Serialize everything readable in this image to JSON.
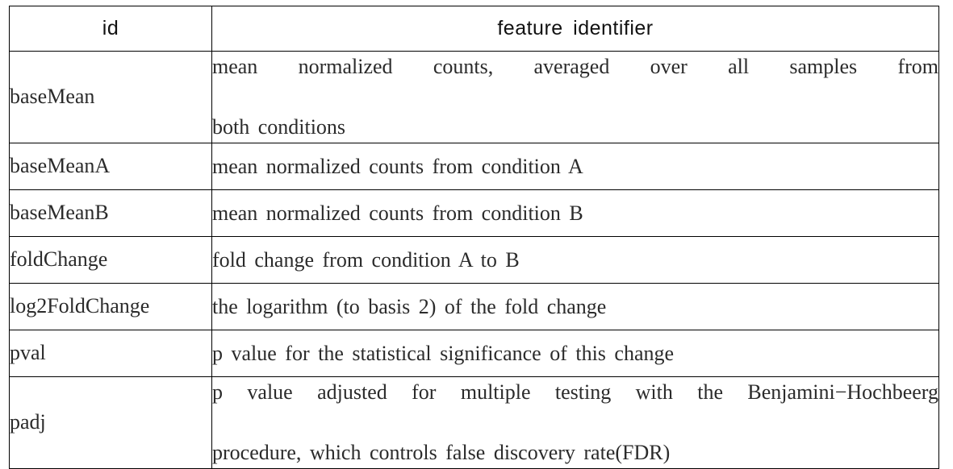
{
  "table": {
    "columns": [
      {
        "key": "id",
        "label": "id"
      },
      {
        "key": "feature_identifier",
        "label": "feature  identifier"
      }
    ],
    "rows": [
      {
        "id": "baseMean",
        "description": "mean normalized counts, averaged over all samples from both conditions",
        "lines": [
          "mean  normalized  counts,  averaged  over  all  samples  from",
          "both  conditions"
        ]
      },
      {
        "id": "baseMeanA",
        "description": "mean normalized counts from condition A",
        "lines": [
          "mean  normalized  counts  from  condition  A"
        ]
      },
      {
        "id": "baseMeanB",
        "description": "mean normalized counts from condition B",
        "lines": [
          "mean  normalized  counts  from  condition  B"
        ]
      },
      {
        "id": "foldChange",
        "description": "fold change from condition A to B",
        "lines": [
          "fold  change  from  condition  A  to  B"
        ]
      },
      {
        "id": "log2FoldChange",
        "description": "the logarithm (to basis 2) of the fold change",
        "lines": [
          "the  logarithm  (to  basis  2)  of  the  fold  change"
        ]
      },
      {
        "id": "pval",
        "description": "p value for the statistical significance of this change",
        "lines": [
          "p  value  for  the  statistical  significance  of  this  change"
        ]
      },
      {
        "id": "padj",
        "description": "p value adjusted for multiple testing with the Benjamini−Hochbeerg procedure, which controls false discovery rate(FDR)",
        "lines": [
          "p  value  adjusted  for  multiple  testing  with  the  Benjamini−Hochbeerg",
          "procedure,  which  controls  false  discovery  rate(FDR)"
        ]
      }
    ]
  },
  "style": {
    "border_color": "#000000",
    "text_color": "#2b2b2b",
    "background": "#ffffff"
  }
}
